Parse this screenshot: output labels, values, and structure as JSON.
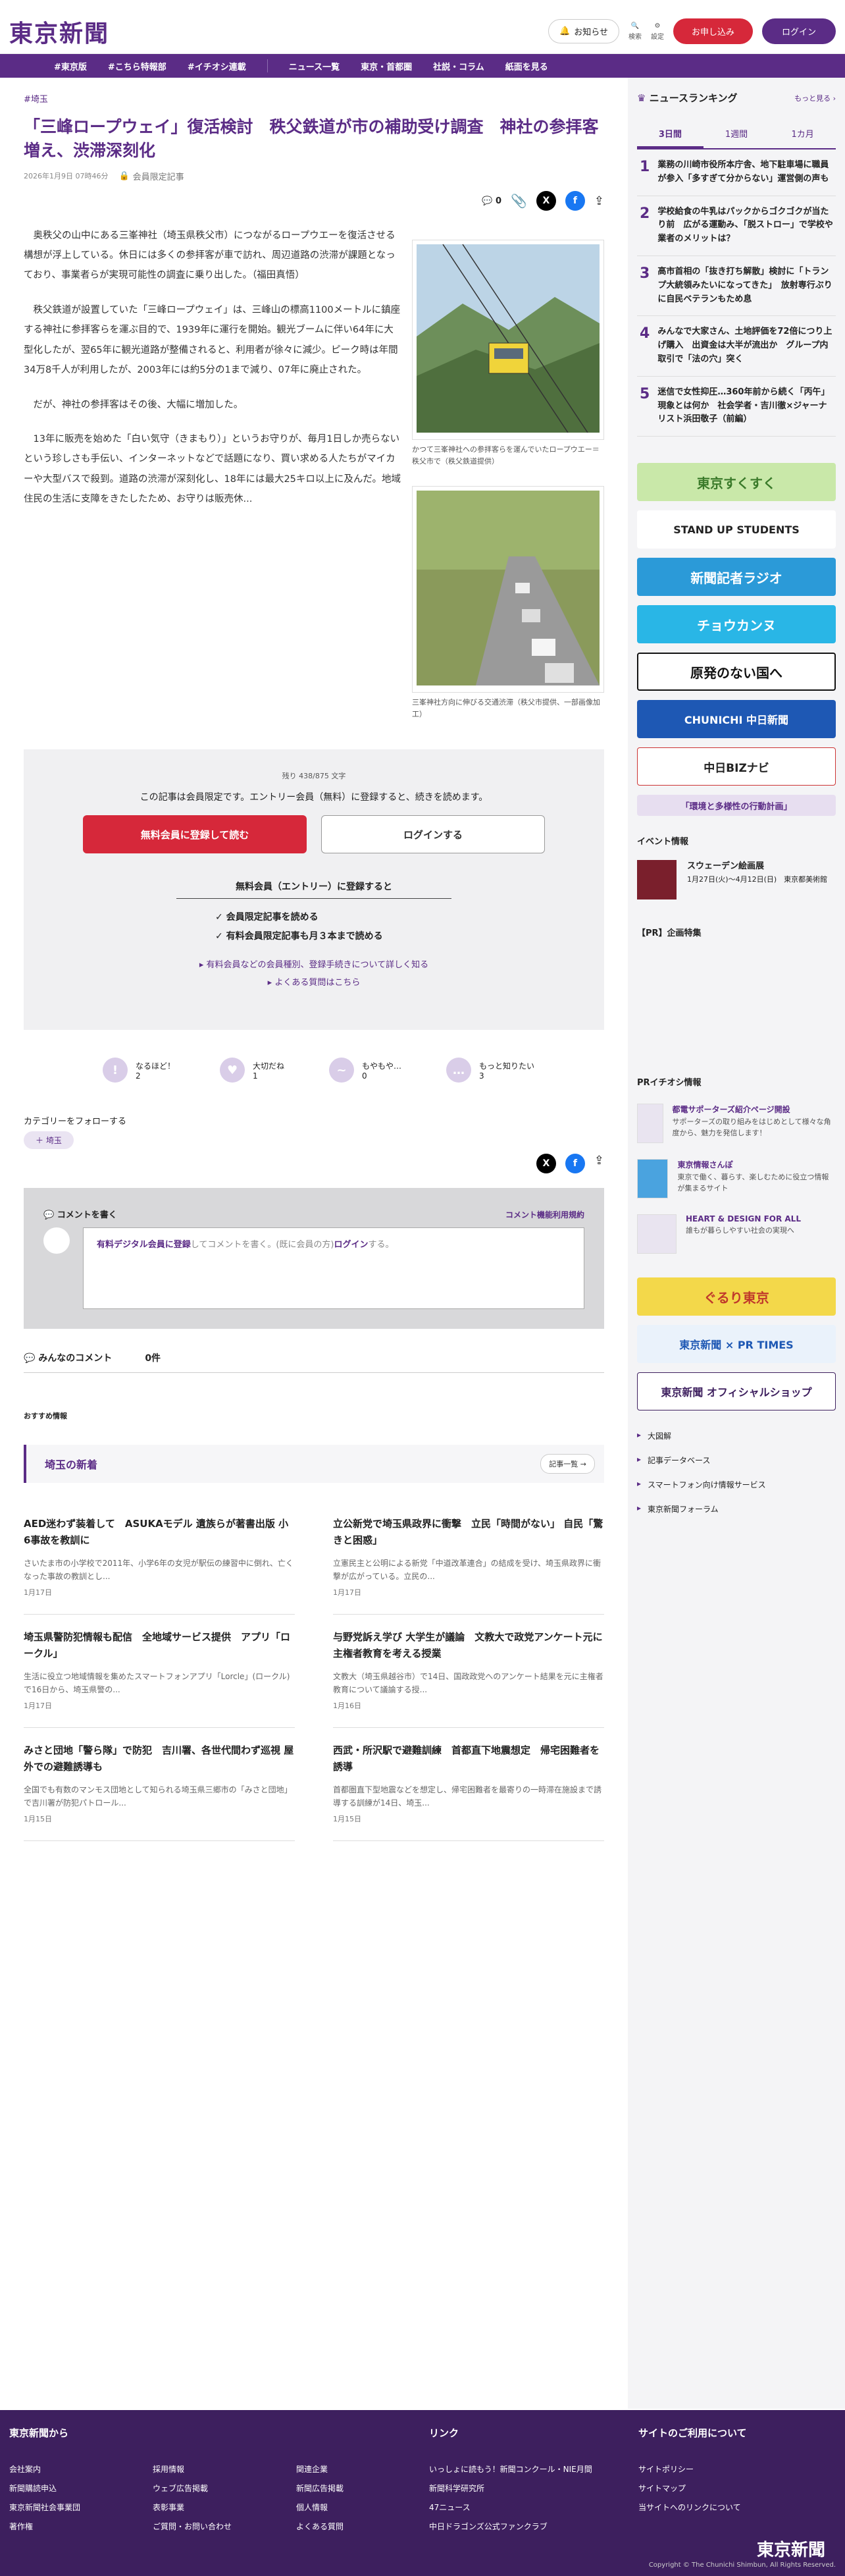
{
  "header": {
    "logo": "東京新聞",
    "notice": "お知らせ",
    "search": "検索",
    "settings": "設定",
    "apply": "お申し込み",
    "login": "ログイン"
  },
  "nav": [
    "#東京版",
    "#こちら特報部",
    "#イチオシ連載",
    "ニュース一覧",
    "東京・首都圏",
    "社説・コラム",
    "紙面を見る"
  ],
  "article": {
    "tag": "#埼玉",
    "title": "「三峰ロープウェイ」復活検討　秩父鉄道が市の補助受け調査　神社の参拝客増え、渋滞深刻化",
    "date": "2026年1月9日 07時46分",
    "member": "会員限定記事",
    "comment_count": "0",
    "paragraphs": [
      "奥秩父の山中にある三峯神社（埼玉県秩父市）につながるロープウエーを復活させる構想が浮上している。休日には多くの参拝客が車で訪れ、周辺道路の渋滞が課題となっており、事業者らが実現可能性の調査に乗り出した。（福田真悟）",
      "秩父鉄道が設置していた「三峰ロープウェイ」は、三峰山の標高1100メートルに鎮座する神社に参拝客らを運ぶ目的で、1939年に運行を開始。観光ブームに伴い64年に大型化したが、翌65年に観光道路が整備されると、利用者が徐々に減少。ピーク時は年間34万8千人が利用したが、2003年には約5分の1まで減り、07年に廃止された。",
      "だが、神社の参拝客はその後、大幅に増加した。",
      "13年に販売を始めた「白い気守（きまもり）」というお守りが、毎月1日しか売らないという珍しさも手伝い、インターネットなどで話題になり、買い求める人たちがマイカーや大型バスで殺到。道路の渋滞が深刻化し、18年には最大25キロ以上に及んだ。地域住民の生活に支障をきたしたため、お守りは販売休..."
    ],
    "fig1_caption": "かつて三峯神社への参拝客らを運んでいたロープウエー＝秩父市で（秩父鉄道提供）",
    "fig2_caption": "三峯神社方向に伸びる交通渋滞（秩父市提供、一部画像加工）"
  },
  "paywall": {
    "remain": "残り 438/875 文字",
    "message": "この記事は会員限定です。エントリー会員（無料）に登録すると、続きを読めます。",
    "register": "無料会員に登録して読む",
    "login": "ログインする",
    "benefit_title": "無料会員（エントリー）に登録すると",
    "benefits": [
      "会員限定記事を読める",
      "有料会員限定記事も月３本まで読める"
    ],
    "link1": "有料会員などの会員種別、登録手続きについて詳しく知る",
    "link2": "よくある質問はこちら"
  },
  "reactions": [
    {
      "label": "なるほど！",
      "count": "2"
    },
    {
      "label": "大切だね",
      "count": "1"
    },
    {
      "label": "もやもや…",
      "count": "0"
    },
    {
      "label": "もっと知りたい",
      "count": "3"
    }
  ],
  "follow": {
    "label": "カテゴリーをフォローする",
    "chip": "埼玉"
  },
  "comments": {
    "header": "コメントを書く",
    "terms": "コメント機能利用規約",
    "placeholder_link": "有料デジタル会員に登録",
    "placeholder_mid": "してコメントを書く。(既に会員の方)",
    "placeholder_login": "ログイン",
    "placeholder_end": "する。",
    "all_label": "みんなのコメント",
    "all_count": "0件"
  },
  "recommend": "おすすめ情報",
  "latest": {
    "title": "埼玉の新着",
    "more": "記事一覧",
    "items": [
      {
        "title": "AED迷わず装着して　ASUKAモデル 遺族らが著書出版 小6事故を教訓に",
        "summary": "さいたま市の小学校で2011年、小学6年の女児が駅伝の練習中に倒れ、亡くなった事故の教訓とし...",
        "date": "1月17日"
      },
      {
        "title": "立公新党で埼玉県政界に衝撃　立民「時間がない」 自民「驚きと困惑」",
        "summary": "立憲民主と公明による新党「中道改革連合」の結成を受け、埼玉県政界に衝撃が広がっている。立民の...",
        "date": "1月17日"
      },
      {
        "title": "埼玉県警防犯情報も配信　全地域サービス提供　アプリ「ロークル」",
        "summary": "生活に役立つ地域情報を集めたスマートフォンアプリ「Lorcle」(ロークル)で16日から、埼玉県警の...",
        "date": "1月17日"
      },
      {
        "title": "与野党訴え学び 大学生が議論　文教大で政党アンケート元に主権者教育を考える授業",
        "summary": "文教大（埼玉県越谷市）で14日、国政政党へのアンケート結果を元に主権者教育について議論する授...",
        "date": "1月16日"
      },
      {
        "title": "みさと団地「警ら隊」で防犯　吉川署、各世代間わず巡視 屋外での避難誘導も",
        "summary": "全国でも有数のマンモス団地として知られる埼玉県三郷市の「みさと団地」で吉川署が防犯パトロール...",
        "date": "1月15日"
      },
      {
        "title": "西武・所沢駅で避難訓練　首都直下地震想定　帰宅困難者を誘導",
        "summary": "首都圏直下型地震などを想定し、帰宅困難者を最寄りの一時滞在施設まで誘導する訓練が14日、埼玉...",
        "date": "1月15日"
      }
    ]
  },
  "sidebar": {
    "ranking_title": "ニュースランキング",
    "ranking_more": "もっと見る",
    "tabs": [
      "3日間",
      "1週間",
      "1カ月"
    ],
    "ranking": [
      {
        "n": "1",
        "t": "業務の川崎市役所本庁舎、地下駐車場に職員が参入「多すぎて分からない」運営側の声も"
      },
      {
        "n": "2",
        "t": "学校給食の牛乳はパックからゴクゴクが当たり前　広がる運動み、「脱ストロー」で学校や業者のメリットは？"
      },
      {
        "n": "3",
        "t": "高市首相の「抜き打ち解散」検討に「トランプ大統領みたいになってきた」　放射専行ぶりに自民ベテランもため息"
      },
      {
        "n": "4",
        "t": "みんなで大家さん、土地評価を72倍につり上げ購入　出資金は大半が流出か　グループ内取引で「法の穴」突く"
      },
      {
        "n": "5",
        "t": "迷信で女性抑圧…360年前から続く「丙午」現象とは何か　社会学者・吉川徹×ジャーナリスト浜田敬子（前編）"
      }
    ],
    "banners": [
      "東京すくすく",
      "STAND UP STUDENTS",
      "新聞記者ラジオ",
      "チョウカンヌ",
      "原発のない国へ",
      "CHUNICHI 中日新聞",
      "中日BIZナビ",
      "「環境と多様性の行動計画」"
    ],
    "event_title": "イベント情報",
    "event": {
      "name": "スウェーデン絵画展",
      "info": "1月27日(火)〜4月12日(日)　東京都美術館"
    },
    "pr_title": "【PR】企画特集",
    "pr_ichioshi": "PRイチオシ情報",
    "pr_items": [
      {
        "t": "都電サポーターズ紹介ページ開設",
        "s": "サポーターズの取り組みをはじめとして様々な角度から、魅力を発信します！"
      },
      {
        "t": "東京情報さんぽ",
        "s": "東京で働く、暮らす、楽しむために役立つ情報が集まるサイト"
      },
      {
        "t": "HEART & DESIGN FOR ALL",
        "s": "誰もが暮らしやすい社会の実現へ"
      }
    ],
    "bottom_banners": [
      "ぐるり東京",
      "東京新聞 × PR TIMES",
      "東京新聞 オフィシャルショップ"
    ],
    "links": [
      "大図解",
      "記事データベース",
      "スマートフォン向け情報サービス",
      "東京新聞フォーラム"
    ]
  },
  "footer": {
    "col1_title": "東京新聞から",
    "col1": [
      "会社案内",
      "新聞購読申込",
      "東京新聞社会事業団",
      "著作権"
    ],
    "col2": [
      "採用情報",
      "ウェブ広告掲載",
      "表彰事業",
      "ご質問・お問い合わせ"
    ],
    "col3": [
      "関連企業",
      "新聞広告掲載",
      "個人情報",
      "よくある質問"
    ],
    "col4_title": "リンク",
    "col4": [
      "いっしょに読もう！新聞コンクール・NIE月間",
      "新聞科学研究所",
      "47ニュース",
      "中日ドラゴンズ公式ファンクラブ"
    ],
    "col5_title": "サイトのご利用について",
    "col5": [
      "サイトポリシー",
      "サイトマップ",
      "当サイトへのリンクについて"
    ],
    "logo": "東京新聞",
    "copyright": "Copyright © The Chunichi Shimbun, All Rights Reserved."
  },
  "colors": {
    "brand": "#5b2c86",
    "accent": "#d6283a"
  }
}
